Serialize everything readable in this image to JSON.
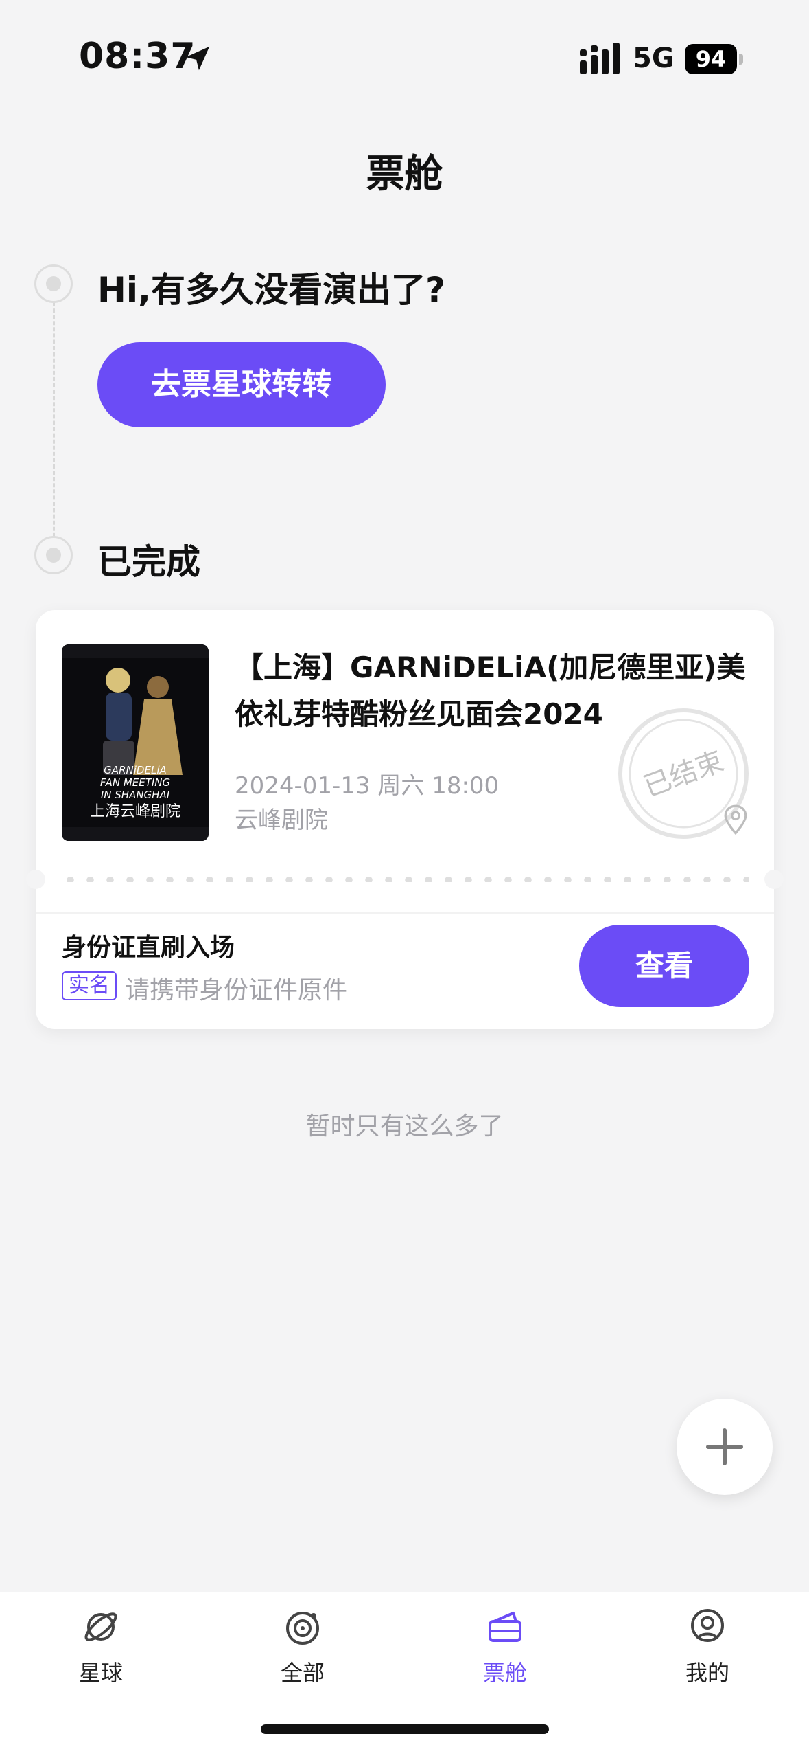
{
  "status_bar": {
    "time": "08:37",
    "network": "5G",
    "battery": "94"
  },
  "header": {
    "title": "票舱"
  },
  "prompt": {
    "greeting": "Hi,有多久没看演出了?",
    "explore_button": "去票星球转转"
  },
  "completed_section": {
    "title": "已完成",
    "ticket": {
      "title": "【上海】GARNiDELiA(加尼德里亚)美依礼芽特酷粉丝见面会2024",
      "datetime": "2024-01-13 周六 18:00",
      "venue": "云峰剧院",
      "stamp": "已结束",
      "poster": {
        "line1": "GARNiDELiA",
        "line2": "FAN MEETING",
        "line3": "IN SHANGHAI",
        "line4": "上海云峰剧院"
      },
      "entry_title": "身份证直刷入场",
      "realname_badge": "实名",
      "entry_note": "请携带身份证件原件",
      "view_button": "查看"
    }
  },
  "end_note": "暂时只有这么多了",
  "fab_icon": "plus-icon",
  "tabs": [
    {
      "label": "星球",
      "icon": "planet-icon",
      "active": false
    },
    {
      "label": "全部",
      "icon": "target-icon",
      "active": false
    },
    {
      "label": "票舱",
      "icon": "ticket-box-icon",
      "active": true
    },
    {
      "label": "我的",
      "icon": "profile-icon",
      "active": false
    }
  ],
  "colors": {
    "accent": "#6b4cf6",
    "background": "#f4f4f5",
    "muted_text": "#a2a2a8"
  }
}
